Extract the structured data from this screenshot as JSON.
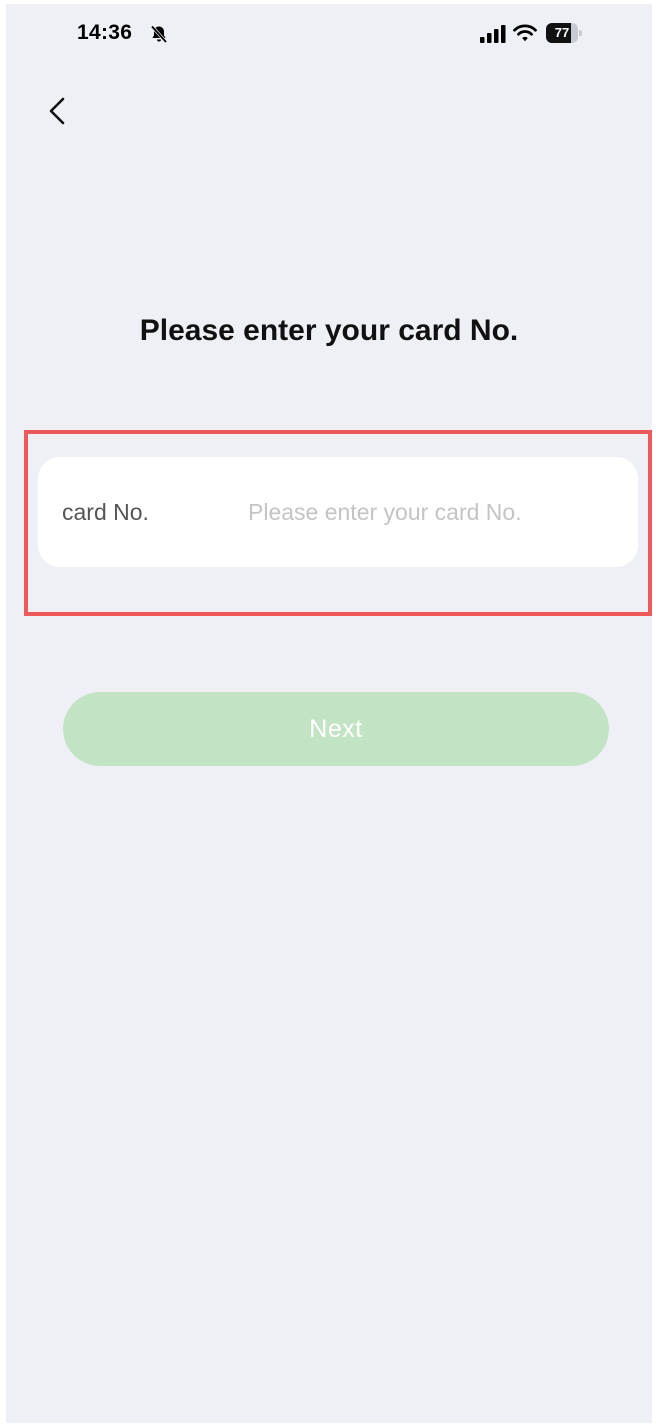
{
  "status_bar": {
    "time": "14:36",
    "battery_level": "77",
    "battery_fraction": 0.77,
    "icons": [
      "bell-off-icon",
      "cellular-signal-icon",
      "wifi-icon",
      "battery-icon"
    ]
  },
  "nav": {
    "back_icon": "chevron-left-icon"
  },
  "main": {
    "title": "Please enter your card No.",
    "card_field": {
      "label": "card No.",
      "value": "",
      "placeholder": "Please enter your card No."
    },
    "next_label": "Next"
  },
  "colors": {
    "background": "#eef0f6",
    "field_background": "#ffffff",
    "highlight_border": "#ee5a5c",
    "next_button_disabled": "#c2e3c4",
    "next_button_text": "#ffffff"
  }
}
